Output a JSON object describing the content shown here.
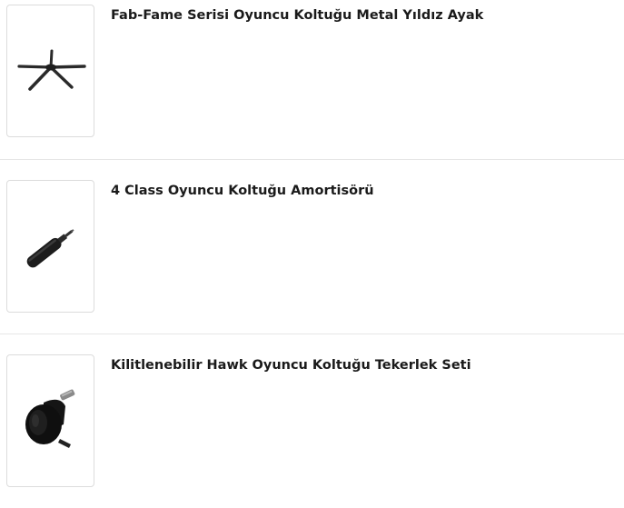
{
  "products": [
    {
      "title": "Fab-Fame Serisi Oyuncu Koltuğu Metal Yıldız Ayak",
      "image_icon": "chair-star-base-icon"
    },
    {
      "title": "4 Class Oyuncu Koltuğu Amortisörü",
      "image_icon": "gas-cylinder-icon"
    },
    {
      "title": "Kilitlenebilir Hawk Oyuncu Koltuğu Tekerlek Seti",
      "image_icon": "caster-wheel-icon"
    }
  ]
}
